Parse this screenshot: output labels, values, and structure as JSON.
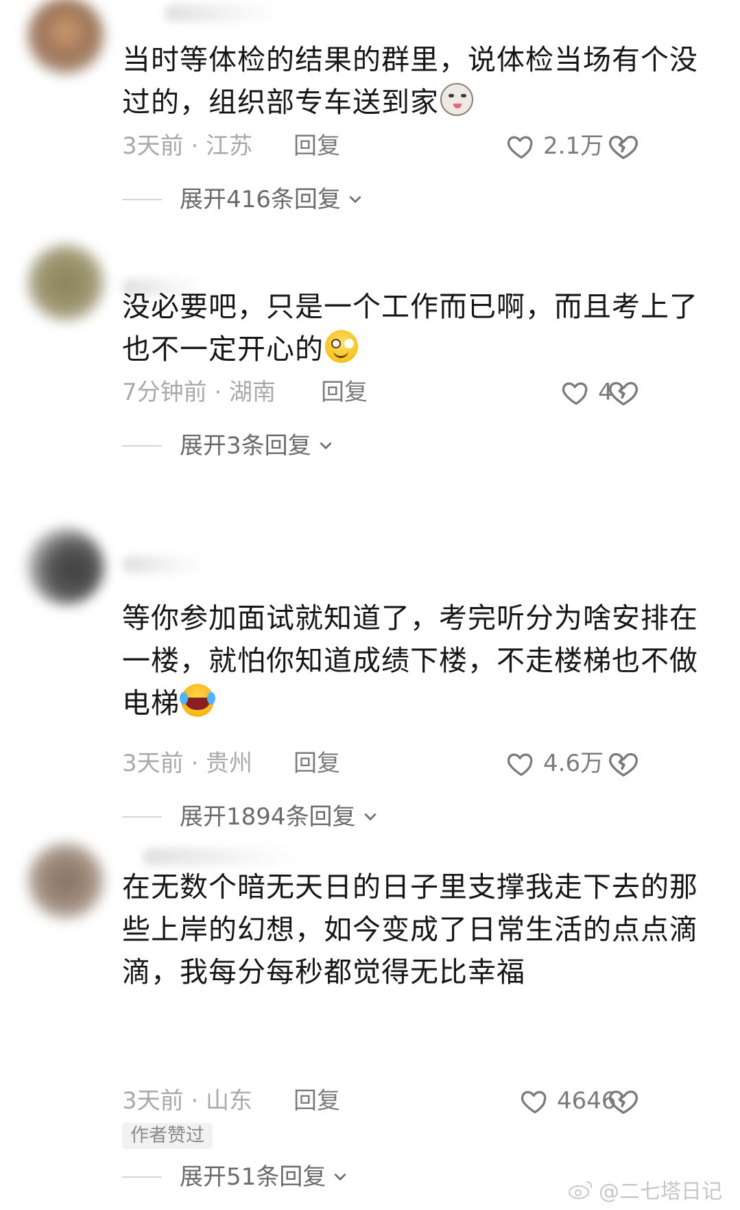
{
  "comments": [
    {
      "text": "当时等体检的结果的群里，说体检当场有个没过的，组织部专车送到家",
      "emoji": "cat-face-emoji",
      "time_location": "3天前 · 江苏",
      "reply_label": "回复",
      "likes": "2.1万",
      "expand_label": "展开416条回复"
    },
    {
      "text": "没必要吧，只是一个工作而已啊，而且考上了也不一定开心的",
      "emoji": "grin-emoji",
      "time_location": "7分钟前 · 湖南",
      "reply_label": "回复",
      "likes": "4",
      "expand_label": "展开3条回复"
    },
    {
      "text": "等你参加面试就知道了，考完听分为啥安排在一楼，就怕你知道成绩下楼，不走楼梯也不做电梯",
      "emoji": "laugh-cry-emoji",
      "time_location": "3天前 · 贵州",
      "reply_label": "回复",
      "likes": "4.6万",
      "expand_label": "展开1894条回复"
    },
    {
      "text": "在无数个暗无天日的日子里支撑我走下去的那些上岸的幻想，如今变成了日常生活的点点滴滴，我每分每秒都觉得无比幸福",
      "emoji": "",
      "time_location": "3天前 · 山东",
      "reply_label": "回复",
      "likes": "4646",
      "author_liked_badge": "作者赞过",
      "expand_label": "展开51条回复"
    }
  ],
  "watermark": "@二七塔日记",
  "colors": {
    "text": "#161616",
    "meta": "#a9a9a9",
    "secondary": "#7b7b7b",
    "expand": "#6a6a6a"
  }
}
